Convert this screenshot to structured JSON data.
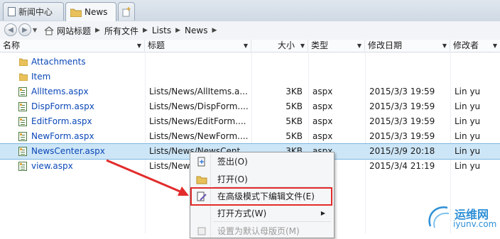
{
  "tabs": [
    {
      "label": "新闻中心",
      "active": false
    },
    {
      "label": "News",
      "active": true
    }
  ],
  "breadcrumbs": [
    "网站标题",
    "所有文件",
    "Lists",
    "News"
  ],
  "columns": {
    "name": "名称",
    "title": "标题",
    "size": "大小",
    "type": "类型",
    "modified": "修改日期",
    "modified_by": "修改者"
  },
  "rows": [
    {
      "name": "Attachments",
      "title": "",
      "size": "",
      "type": "",
      "modified": "",
      "modified_by": "",
      "icon": "folder-icon"
    },
    {
      "name": "Item",
      "title": "",
      "size": "",
      "type": "",
      "modified": "",
      "modified_by": "",
      "icon": "folder-icon"
    },
    {
      "name": "AllItems.aspx",
      "title": "Lists/News/AllItems.a...",
      "size": "3KB",
      "type": "aspx",
      "modified": "2015/3/3 19:59",
      "modified_by": "Lin yu",
      "icon": "aspx-page-icon"
    },
    {
      "name": "DispForm.aspx",
      "title": "Lists/News/DispForm....",
      "size": "5KB",
      "type": "aspx",
      "modified": "2015/3/3 19:59",
      "modified_by": "Lin yu",
      "icon": "aspx-page-icon"
    },
    {
      "name": "EditForm.aspx",
      "title": "Lists/News/EditForm....",
      "size": "5KB",
      "type": "aspx",
      "modified": "2015/3/3 19:59",
      "modified_by": "Lin yu",
      "icon": "aspx-page-icon"
    },
    {
      "name": "NewForm.aspx",
      "title": "Lists/News/NewForm....",
      "size": "5KB",
      "type": "aspx",
      "modified": "2015/3/3 19:59",
      "modified_by": "Lin yu",
      "icon": "aspx-page-icon"
    },
    {
      "name": "NewsCenter.aspx",
      "title": "Lists/News/NewsCent...",
      "size": "3KB",
      "type": "aspx",
      "modified": "2015/3/9 20:18",
      "modified_by": "Lin yu",
      "icon": "aspx-page-icon",
      "selected": true
    },
    {
      "name": "view.aspx",
      "title": "Lists/News/",
      "size": "",
      "type": "",
      "modified": "2015/3/4 21:19",
      "modified_by": "Lin yu",
      "icon": "aspx-page-icon"
    }
  ],
  "context_menu": {
    "items": [
      {
        "label": "签出(O)",
        "icon": "checkout-icon"
      },
      {
        "label": "打开(O)",
        "icon": "open-folder-icon"
      },
      {
        "label": "在高级模式下编辑文件(E)",
        "icon": "edit-page-icon",
        "highlighted": true
      },
      {
        "label": "打开方式(W)",
        "has_submenu": true
      },
      {
        "label": "设置为默认母版页(M)",
        "disabled": true
      }
    ]
  },
  "watermark": {
    "cn": "运维网",
    "url": "iyunv.com"
  },
  "colors": {
    "highlight_box": "#e22b2b",
    "arrow": "#e22b2b",
    "selection": "#cde6f7"
  }
}
